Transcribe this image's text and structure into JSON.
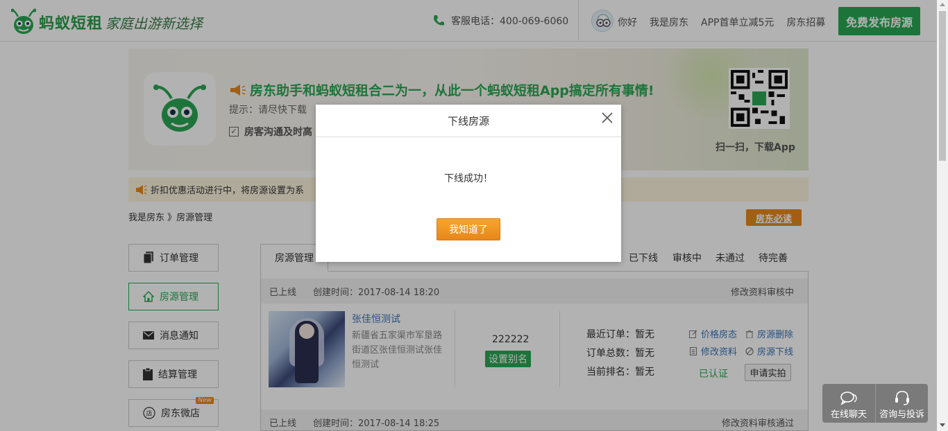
{
  "header": {
    "brand": "蚂蚁短租",
    "slogan": "家庭出游新选择",
    "hotline": "客服电话：400-069-6060",
    "links": [
      "你好",
      "我是房东",
      "APP首单立减5元",
      "房东招募"
    ],
    "publish_button": "免费发布房源"
  },
  "banner": {
    "headline": "房东助手和蚂蚁短租合二为一，从此一个蚂蚁短租App搞定所有事情!",
    "tip": "提示：请尽快下载",
    "feature": "房客沟通及时高",
    "qr_caption": "扫一扫，下载App"
  },
  "notice": {
    "text": "折扣优惠活动进行中，将房源设置为系"
  },
  "breadcrumb": "我是房东 》房源管理",
  "must_read_button": "房东必读",
  "side_menu": [
    {
      "label": "订单管理",
      "icon": "document-icon"
    },
    {
      "label": "房源管理",
      "icon": "home-icon"
    },
    {
      "label": "消息通知",
      "icon": "envelope-icon"
    },
    {
      "label": "结算管理",
      "icon": "clipboard-icon"
    },
    {
      "label": "房东微店",
      "icon": "shop-icon",
      "badge": "New"
    }
  ],
  "tabs": {
    "active": "房源管理",
    "filters": [
      "已下线",
      "审核中",
      "未通过",
      "待完善"
    ]
  },
  "listings": [
    {
      "status": "已上线",
      "created": "创建时间：2017-08-14 18:20",
      "review_state": "修改资料审核中",
      "name": "张佳恒测试",
      "address": "新疆省五家渠市军垦路街道区张佳恒测试张佳恒测试",
      "alias_number": "222222",
      "alias_button": "设置别名",
      "stats": [
        "最近订单：暂无",
        "订单总数：暂无",
        "当前排名：暂无"
      ],
      "ops": [
        "价格房态",
        "房源删除",
        "修改资料",
        "房源下线"
      ],
      "verified": "已认证",
      "apply_button": "申请实拍"
    },
    {
      "status": "已上线",
      "created": "创建时间：2017-08-14 18:25",
      "review_state": "修改资料审核通过"
    }
  ],
  "modal": {
    "title": "下线房源",
    "message": "下线成功！",
    "confirm_button": "我知道了"
  },
  "chat_widget": {
    "chat_label": "在线聊天",
    "complaint_label": "咨询与投诉"
  },
  "colors": {
    "brand_green": "#2aa654",
    "accent_orange": "#e8881a",
    "link_blue": "#3a73b8"
  }
}
